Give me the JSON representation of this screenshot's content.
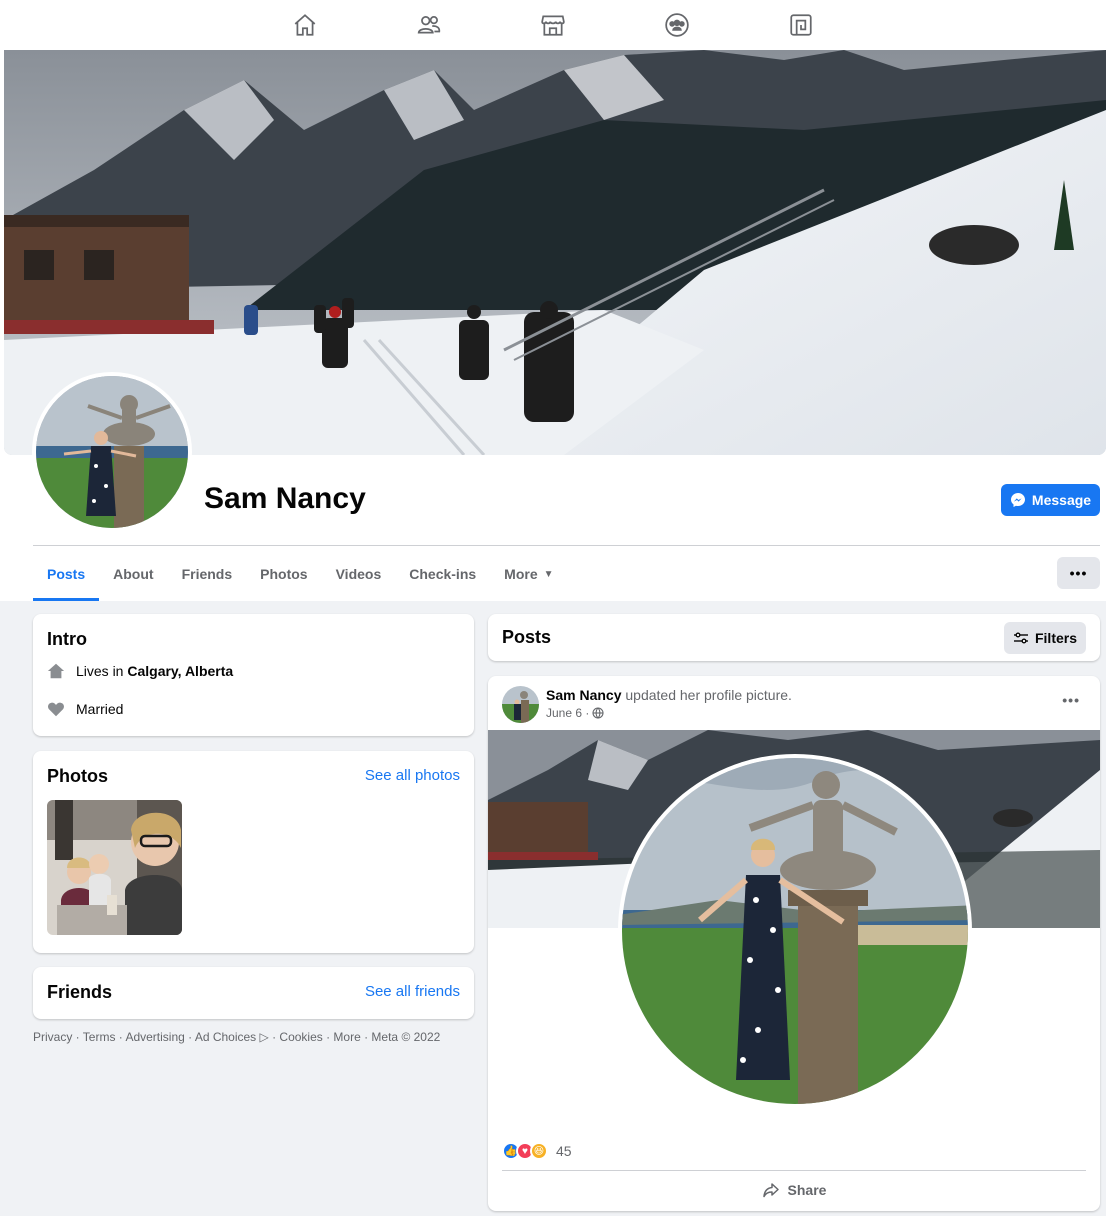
{
  "nav": {
    "items": [
      {
        "name": "home-icon"
      },
      {
        "name": "friends-icon"
      },
      {
        "name": "marketplace-icon"
      },
      {
        "name": "groups-icon"
      },
      {
        "name": "gaming-icon"
      }
    ]
  },
  "profile": {
    "name": "Sam Nancy",
    "message_label": "Message"
  },
  "tabs": [
    "Posts",
    "About",
    "Friends",
    "Photos",
    "Videos",
    "Check-ins",
    "More"
  ],
  "more_dots": "•••",
  "intro": {
    "title": "Intro",
    "lives_prefix": "Lives in ",
    "lives_city": "Calgary, Alberta",
    "relationship": "Married"
  },
  "photos": {
    "title": "Photos",
    "link": "See all photos"
  },
  "friends": {
    "title": "Friends",
    "link": "See all friends"
  },
  "footer": {
    "text": "Privacy · Terms · Advertising · Ad Choices ▷ · Cookies · More · Meta © 2022"
  },
  "posts_header": {
    "title": "Posts",
    "filters_label": "Filters"
  },
  "post": {
    "author": "Sam Nancy",
    "action": " updated her profile picture.",
    "date": "June 6 ·",
    "more": "•••",
    "reaction_count": "45",
    "share_label": "Share"
  },
  "colors": {
    "accent": "#1877f2",
    "background": "#f0f2f5",
    "muted_text": "#65676b"
  }
}
